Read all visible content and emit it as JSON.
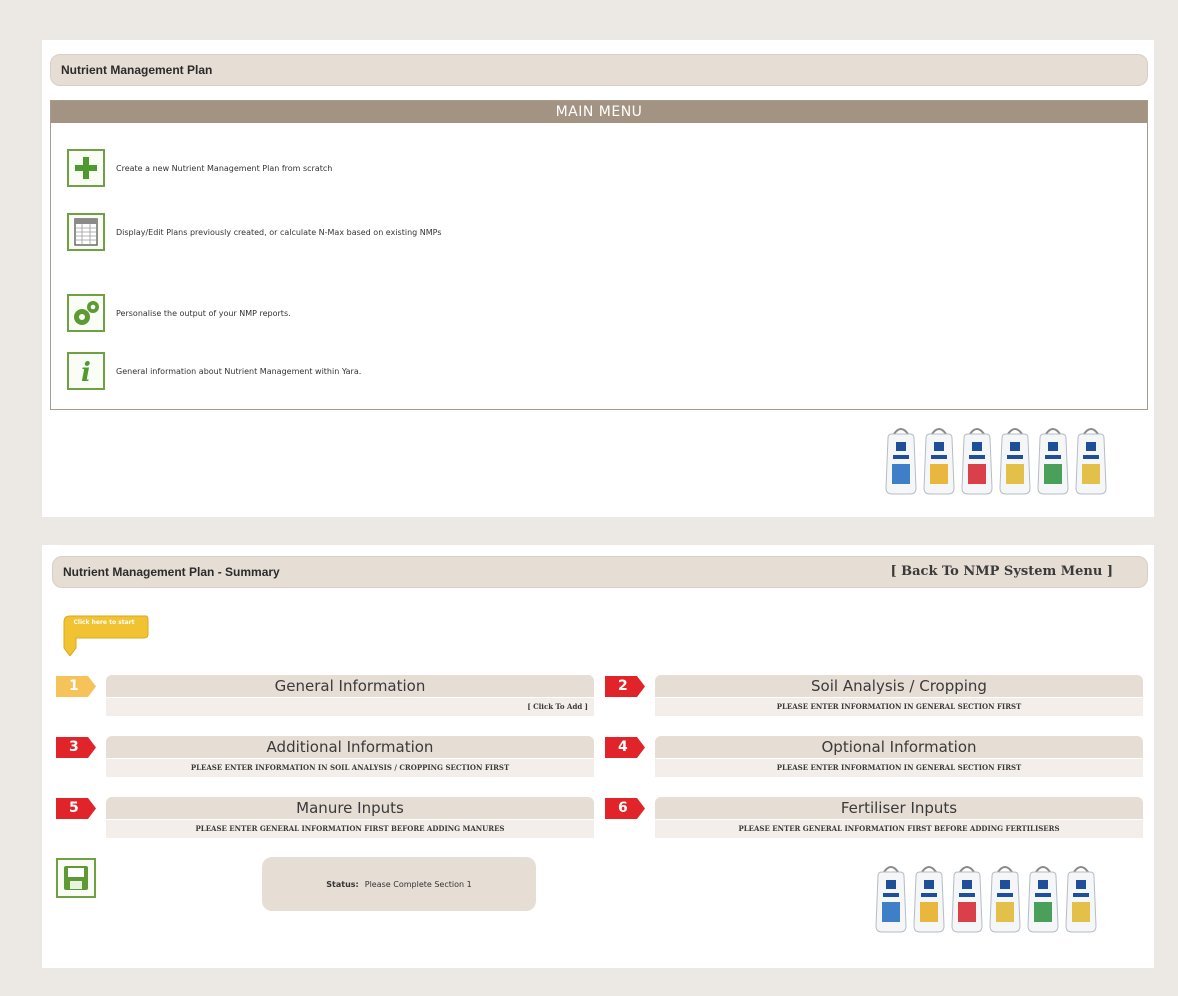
{
  "top": {
    "title": "Nutrient Management Plan",
    "menu_header": "MAIN MENU",
    "items": [
      {
        "icon": "plus-icon",
        "label": "Create a new Nutrient Management Plan from scratch"
      },
      {
        "icon": "spreadsheet-icon",
        "label": "Display/Edit Plans previously created, or calculate N-Max based on existing NMPs"
      },
      {
        "icon": "gears-icon",
        "label": "Personalise the output of your NMP reports."
      },
      {
        "icon": "info-icon",
        "label": "General information about Nutrient Management within Yara."
      }
    ]
  },
  "summary": {
    "title": "Nutrient Management Plan - Summary",
    "back_link": "[ Back To NMP System Menu ]",
    "click_here": "Click here to start",
    "sections": [
      {
        "number": "1",
        "title": "General Information",
        "subtitle": "[ Click To Add ]"
      },
      {
        "number": "2",
        "title": "Soil Analysis / Cropping",
        "subtitle": "PLEASE ENTER INFORMATION IN GENERAL SECTION FIRST"
      },
      {
        "number": "3",
        "title": "Additional Information",
        "subtitle": "PLEASE ENTER INFORMATION IN SOIL ANALYSIS / CROPPING SECTION FIRST"
      },
      {
        "number": "4",
        "title": "Optional Information",
        "subtitle": "PLEASE ENTER INFORMATION IN GENERAL SECTION FIRST"
      },
      {
        "number": "5",
        "title": "Manure Inputs",
        "subtitle": "PLEASE ENTER GENERAL INFORMATION FIRST BEFORE ADDING MANURES"
      },
      {
        "number": "6",
        "title": "Fertiliser Inputs",
        "subtitle": "PLEASE ENTER GENERAL INFORMATION FIRST BEFORE ADDING FERTILISERS"
      }
    ],
    "status_label": "Status:",
    "status_value": "Please Complete Section 1"
  },
  "colors": {
    "badge_active": "#f5c35a",
    "badge_inactive": "#e0242a",
    "accent_green": "#6fa043",
    "header_brown": "#a39383"
  },
  "bag_colors": [
    "#3f7fc8",
    "#e9b73e",
    "#d9404a",
    "#e2c04a",
    "#4aa05a",
    "#e2c04a"
  ]
}
